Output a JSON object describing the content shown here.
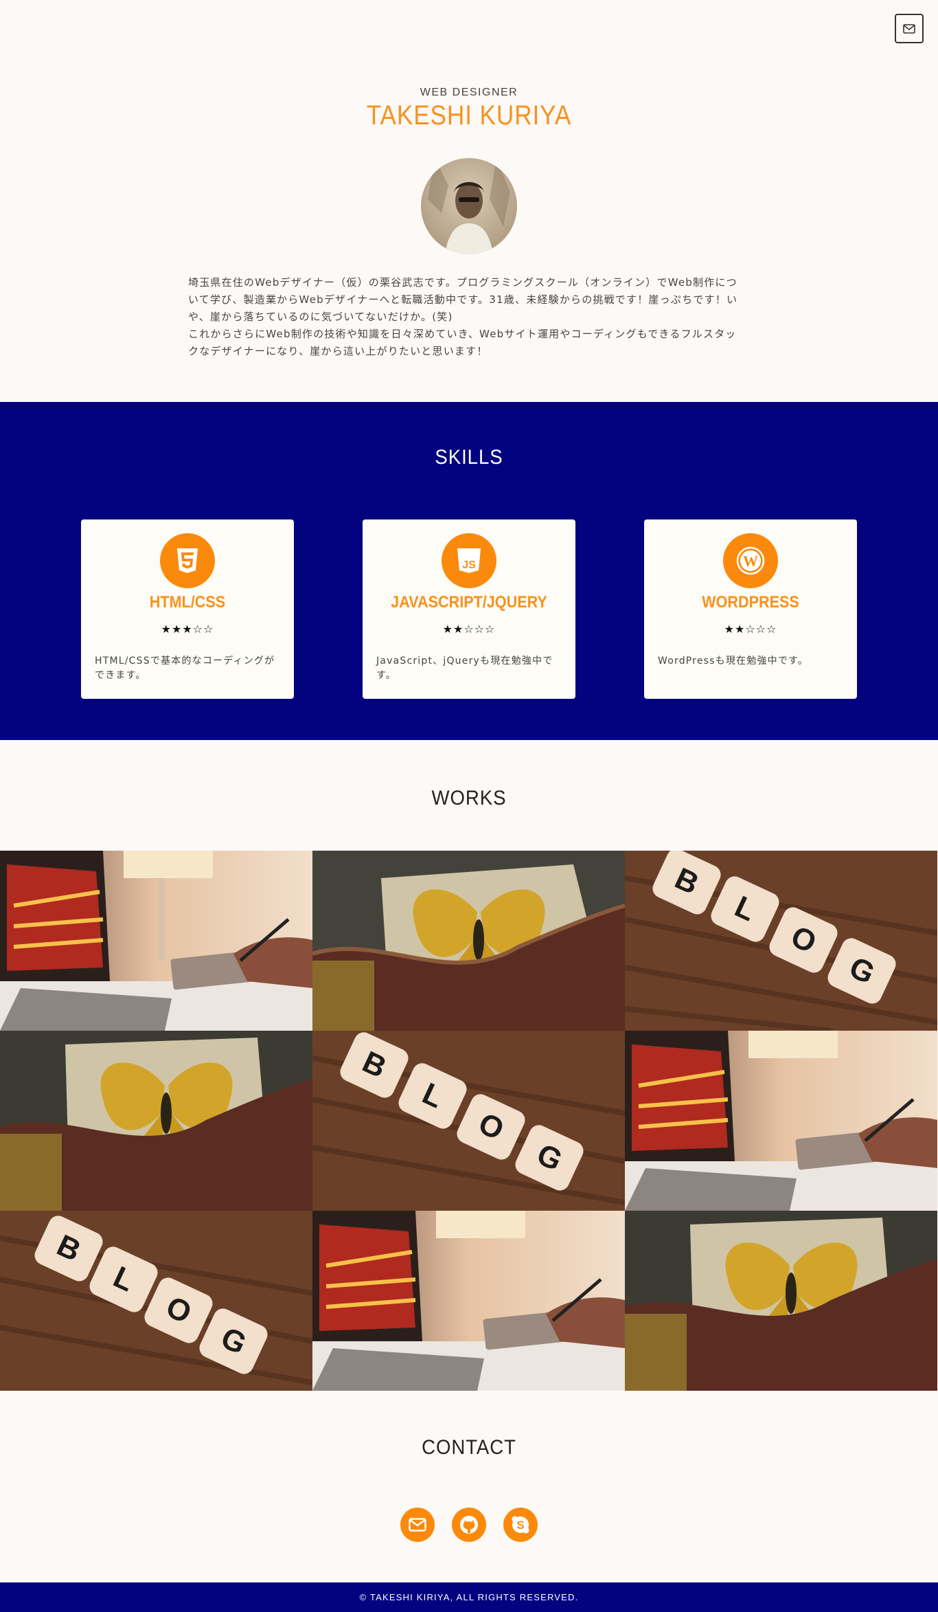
{
  "header": {
    "mail_icon": "envelope-icon"
  },
  "hero": {
    "role": "WEB DESIGNER",
    "name": "TAKESHI KURIYA",
    "bio": [
      "埼玉県在住のWebデザイナー（仮）の栗谷武志です。プログラミングスクール（オンライン）でWeb制作について学び、製造業からWebデザイナーへと転職活動中です。31歳、未経験からの挑戦です！崖っぷちです！いや、崖から落ちているのに気づいてないだけか。(笑)",
      "これからさらにWeb制作の技術や知識を日々深めていき、Webサイト運用やコーディングもできるフルスタックなデザイナーになり、崖から這い上がりたいと思います！"
    ]
  },
  "skills": {
    "title": "SKILLS",
    "items": [
      {
        "icon": "html5-icon",
        "title": "HTML/CSS",
        "rating": 3,
        "max": 5,
        "stars": "★★★☆☆",
        "desc": "HTML/CSSで基本的なコーディングができます。"
      },
      {
        "icon": "javascript-icon",
        "title": "JAVASCRIPT/JQUERY",
        "rating": 2,
        "max": 5,
        "stars": "★★☆☆☆",
        "desc": "JavaScript、jQueryも現在勉強中です。"
      },
      {
        "icon": "wordpress-icon",
        "title": "WORDPRESS",
        "rating": 2,
        "max": 5,
        "stars": "★★☆☆☆",
        "desc": "WordPressも現在勉強中です。"
      }
    ]
  },
  "works": {
    "title": "WORKS",
    "items": [
      {
        "image": "laptop-photo"
      },
      {
        "image": "butterfly-photo"
      },
      {
        "image": "blog-tiles-photo"
      },
      {
        "image": "butterfly-photo"
      },
      {
        "image": "blog-tiles-photo"
      },
      {
        "image": "laptop-photo"
      },
      {
        "image": "blog-tiles-photo"
      },
      {
        "image": "laptop-photo"
      },
      {
        "image": "butterfly-photo"
      }
    ]
  },
  "contact": {
    "title": "CONTACT",
    "links": [
      {
        "icon": "envelope-icon"
      },
      {
        "icon": "github-icon"
      },
      {
        "icon": "skype-icon"
      }
    ]
  },
  "footer": {
    "copyright": "© TAKESHI KIRIYA, ALL RIGHTS RESERVED."
  },
  "colors": {
    "accent": "#f7921d",
    "navy": "#03037f",
    "background": "#fdf9f7"
  }
}
